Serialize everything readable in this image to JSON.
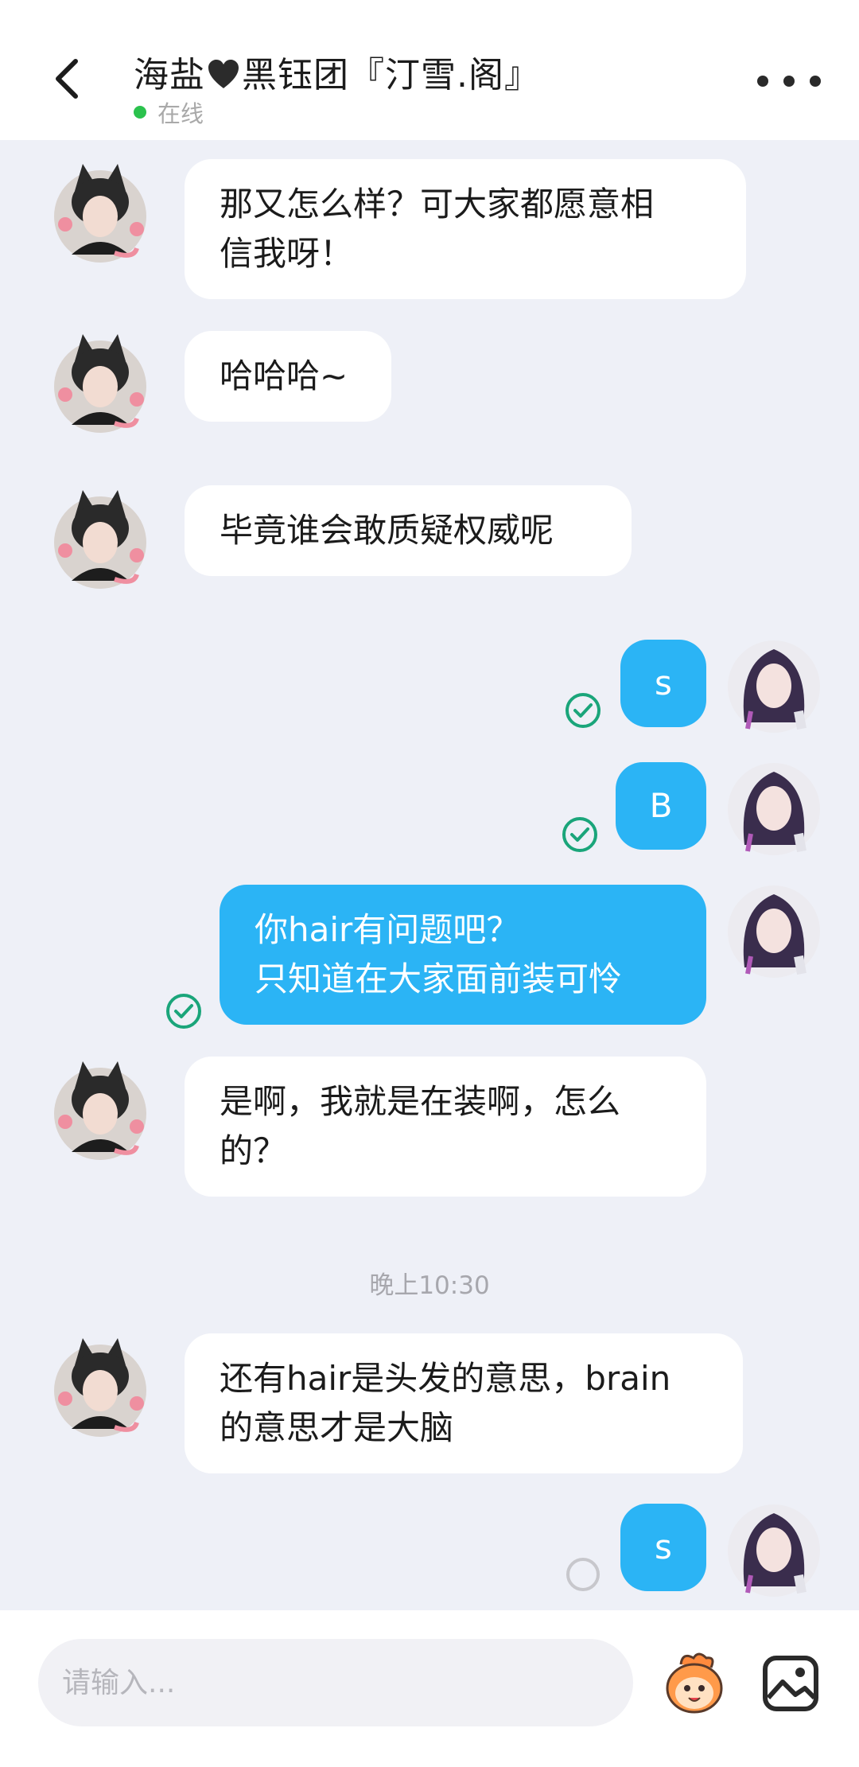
{
  "header": {
    "title_prefix": "海盐",
    "title_suffix": "黑钰团『汀雪.阁』",
    "status_text": "在线"
  },
  "messages": [
    {
      "side": "in",
      "text_lines": [
        "那又怎么样？可大家都愿意相",
        "信我呀！"
      ]
    },
    {
      "side": "in",
      "text_lines": [
        "哈哈哈~"
      ]
    },
    {
      "side": "in",
      "text_lines": [
        "毕竟谁会敢质疑权威呢"
      ]
    },
    {
      "side": "out",
      "text_lines": [
        "s"
      ],
      "read": true
    },
    {
      "side": "out",
      "text_lines": [
        "B"
      ],
      "read": true
    },
    {
      "side": "out",
      "text_lines": [
        "你hair有问题吧？",
        "只知道在大家面前装可怜"
      ],
      "read": true
    },
    {
      "side": "in",
      "text_lines": [
        "是啊，我就是在装啊，怎么",
        "的？"
      ]
    },
    {
      "side": "in",
      "text_lines": [
        "还有hair是头发的意思，brain",
        "的意思才是大脑"
      ]
    },
    {
      "side": "out",
      "text_lines": [
        "s"
      ],
      "read": false
    }
  ],
  "time_separator": "晚上10:30",
  "input": {
    "placeholder": "请输入..."
  },
  "colors": {
    "outgoing_bubble": "#2bb4f5",
    "incoming_bubble": "#ffffff",
    "online_dot": "#2bc24d",
    "read_check": "#1aa57a",
    "background": "#eef0f7"
  },
  "icons": {
    "back": "chevron-left-icon",
    "more": "more-dots-icon",
    "emoji": "emoji-mascot-icon",
    "image": "image-icon"
  }
}
